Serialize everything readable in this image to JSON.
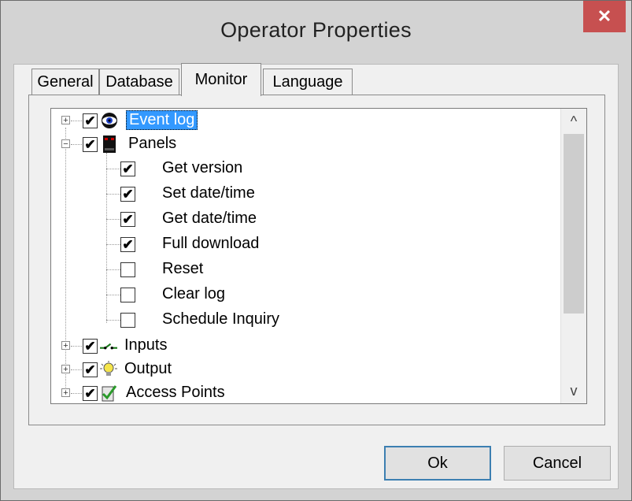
{
  "window": {
    "title": "Operator Properties",
    "close_glyph": "✕"
  },
  "tabs": [
    {
      "label": "General"
    },
    {
      "label": "Database"
    },
    {
      "label": "Monitor",
      "active": true
    },
    {
      "label": "Language"
    }
  ],
  "tree": {
    "nodes": [
      {
        "label": "Event log",
        "checked": true,
        "expander": "+",
        "icon": "eye-icon",
        "selected": true
      },
      {
        "label": "Panels",
        "checked": true,
        "expander": "−",
        "icon": "panel-icon"
      },
      {
        "label": "Get version",
        "checked": true,
        "child": true
      },
      {
        "label": "Set date/time",
        "checked": true,
        "child": true
      },
      {
        "label": "Get date/time",
        "checked": true,
        "child": true
      },
      {
        "label": "Full download",
        "checked": true,
        "child": true
      },
      {
        "label": "Reset",
        "checked": false,
        "child": true
      },
      {
        "label": "Clear log",
        "checked": false,
        "child": true
      },
      {
        "label": "Schedule Inquiry",
        "checked": false,
        "child": true
      },
      {
        "label": "Inputs",
        "checked": true,
        "expander": "+",
        "icon": "switch-icon"
      },
      {
        "label": "Output",
        "checked": true,
        "expander": "+",
        "icon": "lightbulb-icon"
      },
      {
        "label": "Access Points",
        "checked": true,
        "expander": "+",
        "icon": "access-point-icon"
      }
    ],
    "check_glyph": "✔",
    "scroll_up_glyph": "^",
    "scroll_down_glyph": "v"
  },
  "buttons": {
    "ok": "Ok",
    "cancel": "Cancel"
  }
}
